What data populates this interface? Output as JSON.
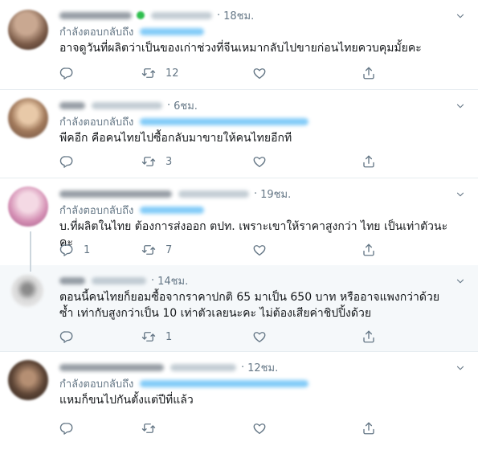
{
  "reply_prefix": "กำลังตอบกลับถึง",
  "tweets": [
    {
      "time": "18ชม.",
      "text": "อาจดูวันที่ผลิตว่าเป็นของเก่าช่วงที่จีนเหมากลับไปขายก่อนไทยควบคุมมั้ยคะ",
      "reply_count": "",
      "retweet_count": "12",
      "like_count": ""
    },
    {
      "time": "6ชม.",
      "text": "พีคอีก คือคนไทยไปซื้อกลับมาขายให้คนไทยอีกที",
      "reply_count": "",
      "retweet_count": "3",
      "like_count": ""
    },
    {
      "time": "19ชม.",
      "text": "บ.ที่ผลิตในไทย ต้องการส่งออก ตปท. เพราะเขาให้ราคาสูงกว่า ไทย เป็นเท่าตัวนะคะ",
      "reply_count": "1",
      "retweet_count": "7",
      "like_count": ""
    },
    {
      "time": "14ชม.",
      "text": "ตอนนี้คนไทยก็ยอมซื้อจากราคาปกติ 65 มาเป็น 650 บาท หรืออาจแพงกว่าด้วยซ้ำ เท่ากับสูงกว่าเป็น 10 เท่าตัวเลยนะคะ ไม่ต้องเสียค่าชิปปิ้งด้วย",
      "reply_count": "",
      "retweet_count": "1",
      "like_count": ""
    },
    {
      "time": "12ชม.",
      "text": "แหมก็ขนไปกันตั้งแต่ปีที่แล้ว",
      "reply_count": "",
      "retweet_count": "",
      "like_count": ""
    }
  ],
  "icons": {
    "reply": "reply-icon",
    "retweet": "retweet-icon",
    "like": "like-icon",
    "share": "share-icon",
    "caret": "chevron-down-icon"
  },
  "colors": {
    "secondary_text": "#657786",
    "link": "#1da1f2",
    "divider": "#e6ecf0",
    "highlight_bg": "#f5f8fa"
  }
}
